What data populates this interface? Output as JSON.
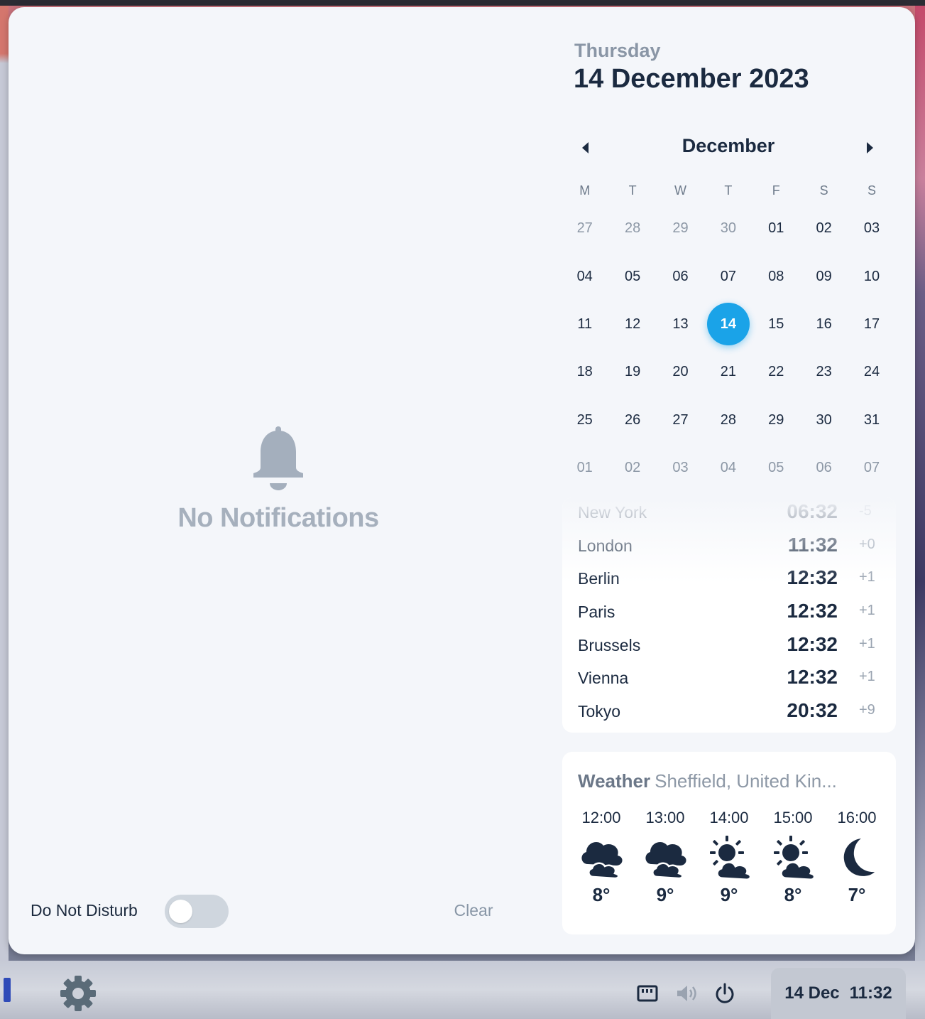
{
  "notifications": {
    "empty_text": "No Notifications",
    "dnd_label": "Do Not Disturb",
    "dnd_enabled": false,
    "clear_label": "Clear"
  },
  "date": {
    "weekday": "Thursday",
    "full": "14 December 2023"
  },
  "calendar": {
    "month": "December",
    "weekdays": [
      "M",
      "T",
      "W",
      "T",
      "F",
      "S",
      "S"
    ],
    "selected": "14",
    "weeks": [
      [
        {
          "d": "27",
          "muted": true
        },
        {
          "d": "28",
          "muted": true
        },
        {
          "d": "29",
          "muted": true
        },
        {
          "d": "30",
          "muted": true
        },
        {
          "d": "01"
        },
        {
          "d": "02"
        },
        {
          "d": "03"
        }
      ],
      [
        {
          "d": "04"
        },
        {
          "d": "05"
        },
        {
          "d": "06"
        },
        {
          "d": "07"
        },
        {
          "d": "08"
        },
        {
          "d": "09"
        },
        {
          "d": "10"
        }
      ],
      [
        {
          "d": "11"
        },
        {
          "d": "12"
        },
        {
          "d": "13"
        },
        {
          "d": "14",
          "selected": true
        },
        {
          "d": "15"
        },
        {
          "d": "16"
        },
        {
          "d": "17"
        }
      ],
      [
        {
          "d": "18"
        },
        {
          "d": "19"
        },
        {
          "d": "20"
        },
        {
          "d": "21"
        },
        {
          "d": "22"
        },
        {
          "d": "23"
        },
        {
          "d": "24"
        }
      ],
      [
        {
          "d": "25"
        },
        {
          "d": "26"
        },
        {
          "d": "27"
        },
        {
          "d": "28"
        },
        {
          "d": "29"
        },
        {
          "d": "30"
        },
        {
          "d": "31"
        }
      ],
      [
        {
          "d": "01",
          "muted": true
        },
        {
          "d": "02",
          "muted": true
        },
        {
          "d": "03",
          "muted": true
        },
        {
          "d": "04",
          "muted": true
        },
        {
          "d": "05",
          "muted": true
        },
        {
          "d": "06",
          "muted": true
        },
        {
          "d": "07",
          "muted": true
        }
      ]
    ]
  },
  "world_clocks": [
    {
      "city": "New York",
      "time": "06:32",
      "offset": "-5"
    },
    {
      "city": "London",
      "time": "11:32",
      "offset": "+0"
    },
    {
      "city": "Berlin",
      "time": "12:32",
      "offset": "+1"
    },
    {
      "city": "Paris",
      "time": "12:32",
      "offset": "+1"
    },
    {
      "city": "Brussels",
      "time": "12:32",
      "offset": "+1"
    },
    {
      "city": "Vienna",
      "time": "12:32",
      "offset": "+1"
    },
    {
      "city": "Tokyo",
      "time": "20:32",
      "offset": "+9"
    }
  ],
  "weather": {
    "label": "Weather",
    "location": "Sheffield, United Kin...",
    "forecast": [
      {
        "time": "12:00",
        "icon": "cloudy-icon",
        "temp": "8°"
      },
      {
        "time": "13:00",
        "icon": "cloudy-icon",
        "temp": "9°"
      },
      {
        "time": "14:00",
        "icon": "partly-sunny-icon",
        "temp": "9°"
      },
      {
        "time": "15:00",
        "icon": "partly-sunny-icon",
        "temp": "8°"
      },
      {
        "time": "16:00",
        "icon": "moon-icon",
        "temp": "7°"
      }
    ]
  },
  "taskbar": {
    "date": "14 Dec",
    "time": "11:32"
  },
  "colors": {
    "accent": "#1aa3e8",
    "text_dark": "#1b2a40",
    "muted": "#8d98a6"
  }
}
